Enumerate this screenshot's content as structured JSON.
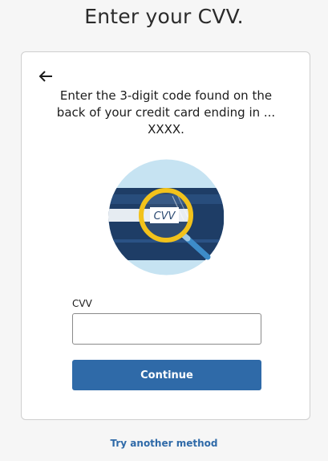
{
  "page": {
    "title": "Enter your CVV."
  },
  "card": {
    "instructions": "Enter the 3-digit code found on the back of your credit card ending in ... XXXX.",
    "illustration_text": "CVV",
    "icons": {
      "back": "back-arrow-icon",
      "illustration": "credit-card-magnifier-icon"
    }
  },
  "form": {
    "cvv_label": "CVV",
    "cvv_value": "",
    "cvv_placeholder": "",
    "continue_label": "Continue"
  },
  "footer": {
    "alt_method_link": "Try another method"
  },
  "colors": {
    "accent": "#2f6aa8",
    "background": "#f6f6f6",
    "card": "#ffffff",
    "illustration_circle": "#c6e3f2",
    "card_art_dark": "#1e3d66",
    "magnifier_ring": "#f2c21b",
    "magnifier_handle": "#3d8cc9"
  }
}
